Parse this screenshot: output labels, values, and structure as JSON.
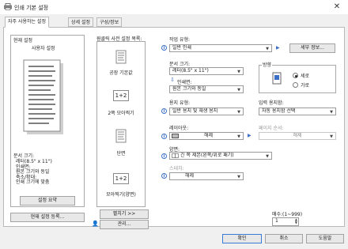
{
  "window": {
    "title": "인쇄 기본 설정",
    "close_glyph": "✕"
  },
  "tabs": [
    {
      "label": "자주 사용하는 설정"
    },
    {
      "label": "상세 설정"
    },
    {
      "label": "구성/정보"
    }
  ],
  "current_settings": {
    "heading": "현재 설정",
    "subheading": "사용자 설정",
    "details": [
      "문서 크기:",
      "레터(8.5\" x 11\")",
      "인쇄면:",
      "원본 크기와 동일",
      "축소/확대:",
      "인쇄 크기에 맞춤"
    ],
    "summary_button": "설정 요약",
    "register_button": "현재 설정 등록..."
  },
  "favorites": {
    "heading": "원클릭 사전 설정 목록:",
    "items": [
      {
        "label": "공장 기본값",
        "icon_text": ""
      },
      {
        "label": "2쪽 모아찍기",
        "icon_text": "1+2"
      },
      {
        "label": "단면",
        "icon_text": ""
      },
      {
        "label": "모아찍기(양면)",
        "icon_text": "1+2"
      }
    ],
    "expand_button": "펼치기 >>",
    "manage_button": "관리..."
  },
  "job_type": {
    "label": "작업 유형:",
    "value": "일반 인쇄",
    "details_button": "세부 정보..."
  },
  "document_size": {
    "label": "문서 크기:",
    "value": "레터(8.5\" x 11\")"
  },
  "print_on": {
    "label": "인쇄면:",
    "value": "원본 크기와 동일"
  },
  "paper_type": {
    "label": "용지 유형:",
    "value": "일반 용지 및 재생 용지"
  },
  "orientation": {
    "label": "방향",
    "options": [
      "세로",
      "가로"
    ],
    "selected": "세로"
  },
  "input_tray": {
    "label": "입력 용지함:",
    "value": "자동 용지함 선택"
  },
  "layout": {
    "label": "레이아웃:",
    "value": "해제"
  },
  "page_order": {
    "label": "페이지 순서:",
    "value": "해제"
  },
  "duplex": {
    "label": "양면:",
    "value": "긴 쪽 제본(왼쪽/위로 패기)"
  },
  "staple": {
    "label": "스테치:",
    "value": "해제"
  },
  "copies": {
    "label": "매수:(1~999)",
    "value": "1"
  },
  "footer": {
    "ok": "확인",
    "cancel": "취소",
    "help": "도움말"
  },
  "colors": {
    "accent": "#3a6ec7",
    "panel": "#ffffff",
    "background": "#f0f0f0"
  }
}
